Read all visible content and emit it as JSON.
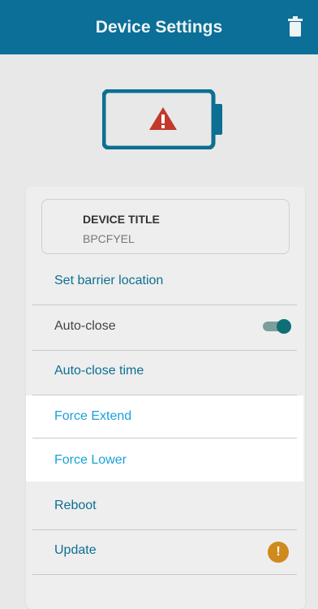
{
  "header": {
    "title": "Device Settings",
    "icon": "trash-icon"
  },
  "device": {
    "label": "DEVICE TITLE",
    "value": "BPCFYEL"
  },
  "menu": [
    {
      "label": "Set barrier location"
    },
    {
      "label": "Auto-close"
    },
    {
      "label": "Auto-close time"
    },
    {
      "label": "Force Extend"
    },
    {
      "label": "Force Lower"
    },
    {
      "label": "Reboot"
    },
    {
      "label": "Update"
    }
  ],
  "status": {
    "battery_icon": "battery-warning-icon",
    "auto_close_enabled": true,
    "update_badge": "!"
  },
  "colors": {
    "accent": "#1aa0d9",
    "warning": "#cf8a1d",
    "alert": "#c0392b"
  }
}
